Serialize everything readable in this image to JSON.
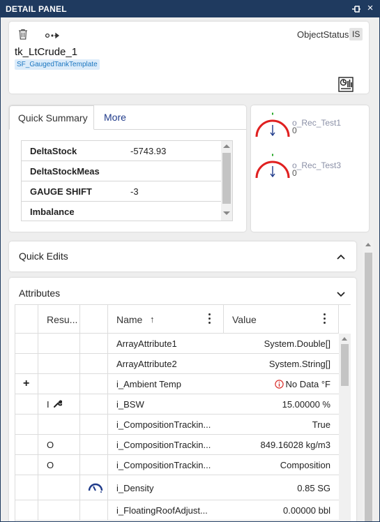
{
  "window": {
    "title": "DETAIL PANEL",
    "pin_icon": "pin-icon",
    "close_icon": "close-icon"
  },
  "header": {
    "object_name": "tk_LtCrude_1",
    "template": "SF_GaugedTankTemplate",
    "object_status_label": "ObjectStatus",
    "object_status_value": "IS"
  },
  "summary": {
    "tabs": [
      {
        "label": "Quick Summary",
        "active": true
      },
      {
        "label": "More",
        "active": false
      }
    ],
    "rows": [
      {
        "key": "DeltaStock",
        "value": "-5743.93"
      },
      {
        "key": "DeltaStockMeas",
        "value": ""
      },
      {
        "key": "GAUGE SHIFT",
        "value": "-3"
      },
      {
        "key": "Imbalance",
        "value": ""
      }
    ]
  },
  "gauges": [
    {
      "label": "o_Rec_Test1",
      "value": "0"
    },
    {
      "label": "o_Rec_Test3",
      "value": "0"
    }
  ],
  "quick_edits": {
    "label": "Quick Edits"
  },
  "attributes": {
    "label": "Attributes",
    "columns": {
      "result": "Resu...",
      "name": "Name",
      "value": "Value"
    },
    "rows": [
      {
        "result": "",
        "name": "ArrayAttribute1",
        "value": "System.Double[]"
      },
      {
        "result": "",
        "name": "ArrayAttribute2",
        "value": "System.String[]"
      },
      {
        "result": "",
        "name": "i_Ambient Temp",
        "value": "No Data °F"
      },
      {
        "result": "I",
        "name": "i_BSW",
        "value": "15.00000 %"
      },
      {
        "result": "",
        "name": "i_CompositionTrackin...",
        "value": "True"
      },
      {
        "result": "O",
        "name": "i_CompositionTrackin...",
        "value": "849.16028 kg/m3"
      },
      {
        "result": "O",
        "name": "i_CompositionTrackin...",
        "value": "Composition"
      },
      {
        "result": "",
        "name": "i_Density",
        "value": "0.85 SG"
      },
      {
        "result": "",
        "name": "i_FloatingRoofAdjust...",
        "value": "0.00000 bbl"
      }
    ]
  },
  "colors": {
    "titlebar": "#1f3a5f",
    "accent_blue": "#1f3a8a",
    "gauge_red": "#e02020",
    "gauge_green": "#2aa82a",
    "warning": "#d9302c"
  }
}
